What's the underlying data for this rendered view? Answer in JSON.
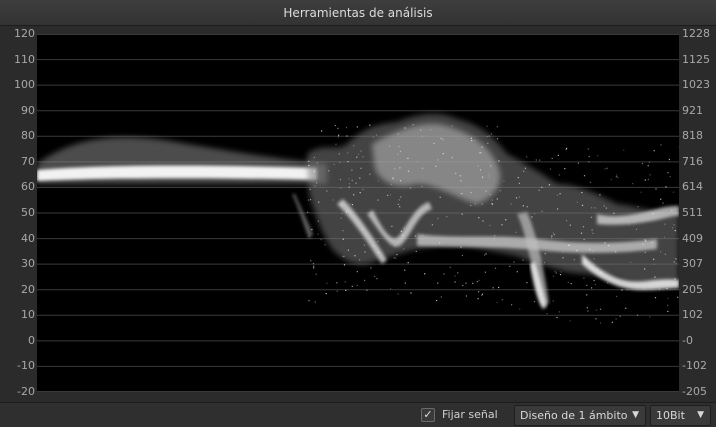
{
  "window": {
    "title": "Herramientas de análisis"
  },
  "scope": {
    "type": "waveform",
    "left_axis": {
      "range": [
        -20,
        120
      ],
      "ticks": [
        "120",
        "110",
        "100",
        "90",
        "80",
        "70",
        "60",
        "50",
        "40",
        "30",
        "20",
        "10",
        "0",
        "-10",
        "-20"
      ]
    },
    "right_axis": {
      "range": [
        -205,
        1228
      ],
      "ticks": [
        "1228",
        "1125",
        "1023",
        "921",
        "818",
        "716",
        "614",
        "511",
        "409",
        "307",
        "205",
        "102",
        "-0",
        "-102",
        "-205"
      ]
    },
    "gridlines_at": [
      120,
      110,
      100,
      90,
      80,
      70,
      60,
      50,
      40,
      30,
      20,
      10,
      0,
      -10,
      -20
    ],
    "trace_color": "#e8e8e8",
    "gridline_color": "#3a3a3a"
  },
  "bottombar": {
    "lock_signal": {
      "label": "Fijar señal",
      "checked": true,
      "check_glyph": "✓"
    },
    "layout_dropdown": {
      "value": "Diseño de 1 ámbito",
      "arrow": "▼"
    },
    "bits_dropdown": {
      "value": "10Bit",
      "arrow": "▼"
    }
  }
}
